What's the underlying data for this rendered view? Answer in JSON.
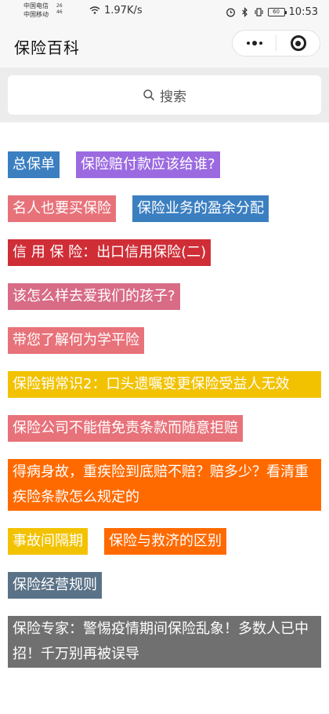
{
  "status_bar": {
    "carrier_1": "中国电信",
    "carrier_2": "中国移动",
    "net_1": "26",
    "net_2": "46",
    "speed": "1.97K/s",
    "battery": "60",
    "time": "10:53"
  },
  "nav": {
    "title": "保险百科",
    "more_icon": "more-dots-icon",
    "close_icon": "target-circle-icon"
  },
  "search": {
    "placeholder": "搜索",
    "icon": "search-icon"
  },
  "tags": [
    {
      "label": "总保单",
      "color": "#3b7fc1"
    },
    {
      "label": "保险赔付款应该给谁?",
      "color": "#9b6ae0"
    },
    {
      "label": "名人也要买保险",
      "color": "#e8727a"
    },
    {
      "label": "保险业务的盈余分配",
      "color": "#3b7fc1"
    },
    {
      "label": "信 用 保 险：出口信用保险(二)",
      "color": "#cf2e37"
    },
    {
      "label": "该怎么样去爱我们的孩子?",
      "color": "#d86b86"
    },
    {
      "label": "带您了解何为学平险",
      "color": "#e8727a"
    },
    {
      "label": "保险销常识2：口头遗嘱变更保险受益人无效",
      "color": "#f2c200"
    },
    {
      "label": "保险公司不能借免责条款而随意拒赔",
      "color": "#e8727a"
    },
    {
      "label": "得病身故，重疾险到底赔不赔？赔多少？看清重疾险条款怎么规定的",
      "color": "#ff6a00"
    },
    {
      "label": "事故间隔期",
      "color": "#f2c200"
    },
    {
      "label": "保险与救济的区别",
      "color": "#ff6a00"
    },
    {
      "label": "保险经营规则",
      "color": "#5a7287"
    },
    {
      "label": "保险专家：警惕疫情期间保险乱象！多数人已中招！千万别再被误导",
      "color": "#707070"
    }
  ]
}
